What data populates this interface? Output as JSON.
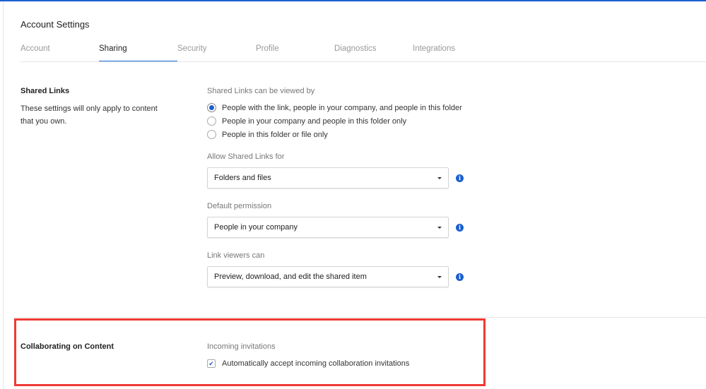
{
  "header": {
    "title": "Account Settings"
  },
  "tabs": [
    {
      "label": "Account"
    },
    {
      "label": "Sharing",
      "active": true
    },
    {
      "label": "Security"
    },
    {
      "label": "Profile"
    },
    {
      "label": "Diagnostics"
    },
    {
      "label": "Integrations"
    }
  ],
  "shared_links": {
    "title": "Shared Links",
    "description": "These settings will only apply to content that you own.",
    "viewed_by_label": "Shared Links can be viewed by",
    "viewed_by_options": [
      {
        "label": "People with the link, people in your company, and people in this folder",
        "selected": true
      },
      {
        "label": "People in your company and people in this folder only",
        "selected": false
      },
      {
        "label": "People in this folder or file only",
        "selected": false
      }
    ],
    "allow_label": "Allow Shared Links for",
    "allow_value": "Folders and files",
    "permission_label": "Default permission",
    "permission_value": "People in your company",
    "viewers_label": "Link viewers can",
    "viewers_value": "Preview, download, and edit the shared item",
    "info_glyph": "i"
  },
  "collaborating": {
    "title": "Collaborating on Content",
    "invitations_label": "Incoming invitations",
    "auto_accept_label": "Automatically accept incoming collaboration invitations",
    "auto_accept_checked": true,
    "check_glyph": "✔"
  },
  "colors": {
    "accent": "#1a5fd0",
    "highlight": "#f03a33"
  }
}
